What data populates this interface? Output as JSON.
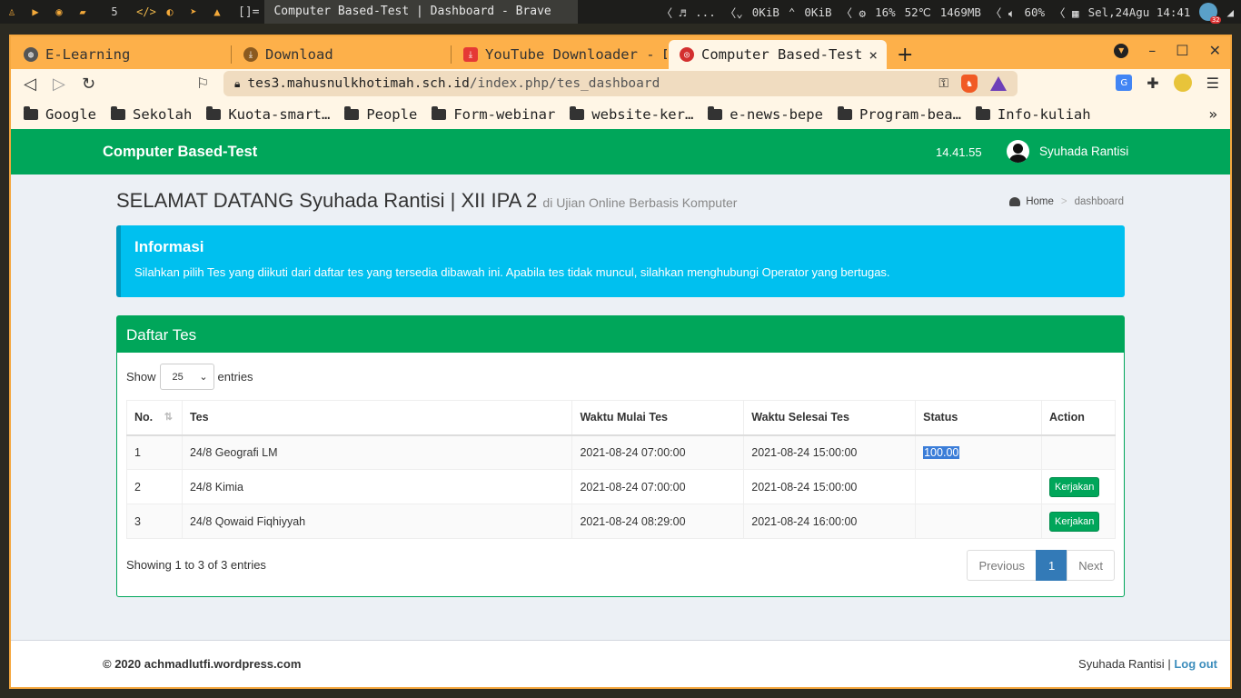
{
  "system_bar": {
    "workspace_number": "5",
    "code_glyph": "</>",
    "layout_indicator": "[]=",
    "window_title": "Computer Based-Test | Dashboard - Brave",
    "music_dots": "...",
    "net_down": "0KiB",
    "net_up": "0KiB",
    "cpu": "16%",
    "temp": "52℃",
    "memory": "1469MB",
    "volume": "60%",
    "datetime": "Sel,24Agu 14:41",
    "notif_badge": "32"
  },
  "browser": {
    "tabs": [
      {
        "label": "E-Learning",
        "fav_color": "#555555"
      },
      {
        "label": "Download",
        "fav_color": "#8a5a20"
      },
      {
        "label": "YouTube Downloader - Do",
        "fav_color": "#e53935"
      },
      {
        "label": "Computer Based-Test",
        "fav_color": "#d32f2f"
      }
    ],
    "active_tab_close": "×",
    "url_host": "tes3.mahusnulkhotimah.sch.id",
    "url_path": "/index.php/tes_dashboard",
    "bookmarks": [
      "Google",
      "Sekolah",
      "Kuota-smart…",
      "People",
      "Form-webinar",
      "website-ker…",
      "e-news-bepe",
      "Program-bea…",
      "Info-kuliah"
    ],
    "more_bookmarks": "»"
  },
  "app": {
    "brand": "Computer Based-Test",
    "clock": "14.41.55",
    "user_name": "Syuhada Rantisi",
    "page_title": "SELAMAT DATANG Syuhada Rantisi | XII IPA 2",
    "page_subtitle": "di Ujian Online Berbasis Komputer",
    "breadcrumb_home": "Home",
    "breadcrumb_current": "dashboard",
    "callout_title": "Informasi",
    "callout_text": "Silahkan pilih Tes yang diikuti dari daftar tes yang tersedia dibawah ini. Apabila tes tidak muncul, silahkan menghubungi Operator yang bertugas.",
    "box_title": "Daftar Tes",
    "length_show": "Show",
    "length_value": "25",
    "length_entries": "entries",
    "columns": [
      "No.",
      "Tes",
      "Waktu Mulai Tes",
      "Waktu Selesai Tes",
      "Status",
      "Action"
    ],
    "rows": [
      {
        "no": "1",
        "tes": "24/8 Geografi LM",
        "mulai": "2021-08-24 07:00:00",
        "selesai": "2021-08-24 15:00:00",
        "status": "100.00",
        "action": ""
      },
      {
        "no": "2",
        "tes": "24/8 Kimia",
        "mulai": "2021-08-24 07:00:00",
        "selesai": "2021-08-24 15:00:00",
        "status": "",
        "action": "Kerjakan"
      },
      {
        "no": "3",
        "tes": "24/8 Qowaid Fiqhiyyah",
        "mulai": "2021-08-24 08:29:00",
        "selesai": "2021-08-24 16:00:00",
        "status": "",
        "action": "Kerjakan"
      }
    ],
    "info_text": "Showing 1 to 3 of 3 entries",
    "pagination": {
      "previous": "Previous",
      "current": "1",
      "next": "Next"
    },
    "footer_copyright": "© 2020 achmadlutfi.wordpress.com",
    "footer_user": "Syuhada Rantisi",
    "footer_separator": "|",
    "footer_logout": "Log out"
  },
  "colors": {
    "header_green": "#00a65a",
    "callout_blue": "#00c0ef",
    "browser_orange": "#fdb04a",
    "page_bg": "#ecf0f5",
    "pagination_active": "#337ab7"
  }
}
